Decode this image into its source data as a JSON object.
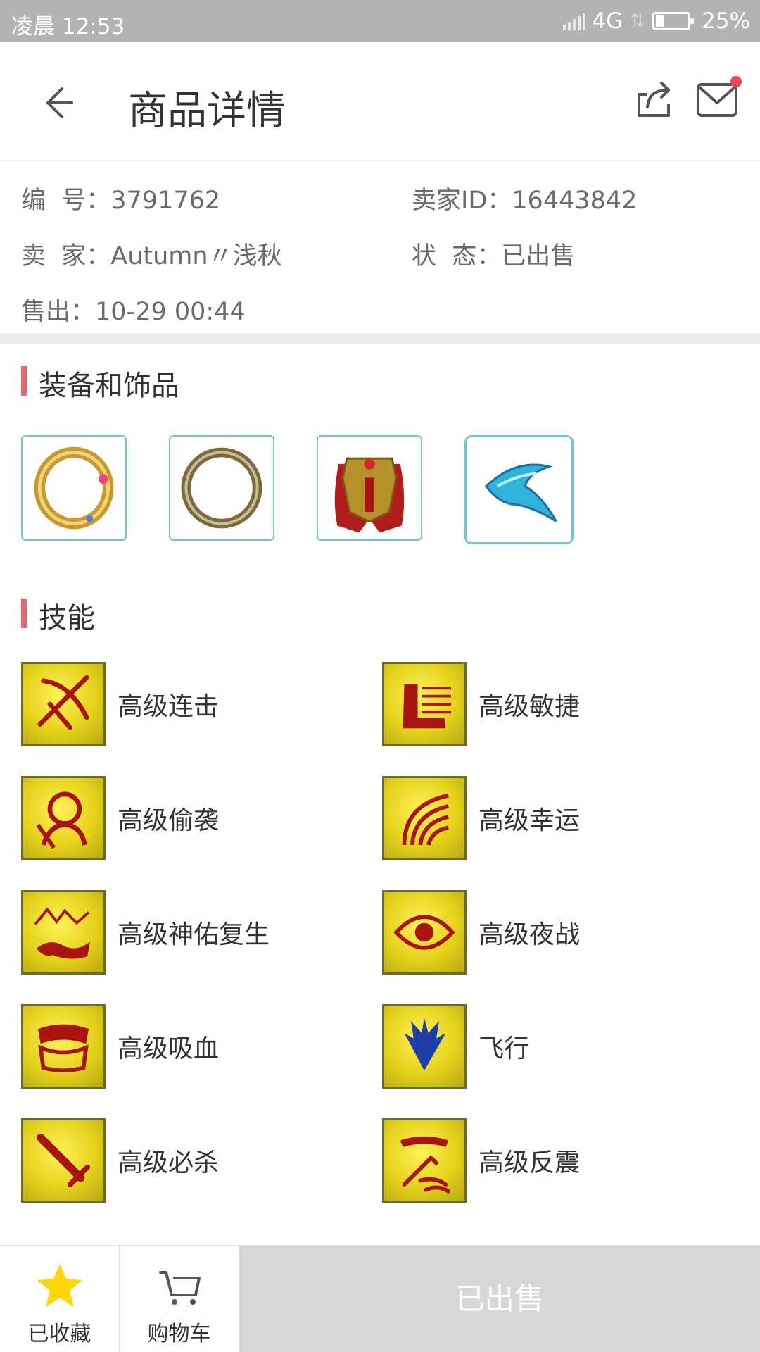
{
  "status_bar": {
    "time": "凌晨 12:53",
    "network": "4G",
    "battery": "25%",
    "battery_level": 0.25
  },
  "header": {
    "title": "商品详情"
  },
  "info": {
    "number_label": "编  号：",
    "number_value": "3791762",
    "seller_id_label": "卖家ID：",
    "seller_id_value": "16443842",
    "seller_label": "卖  家：",
    "seller_value": "Autumn〃浅秋",
    "state_label": "状  态：",
    "state_value": "已出售",
    "sold_label": "售出：",
    "sold_value": "10-29 00:44"
  },
  "equipment": {
    "title": "装备和饰品",
    "items": [
      {
        "icon": "gold-ring-icon"
      },
      {
        "icon": "silver-ring-icon"
      },
      {
        "icon": "golden-armor-icon"
      },
      {
        "icon": "blue-claw-icon"
      }
    ]
  },
  "skills": {
    "title": "技能",
    "items": [
      {
        "label": "高级连击",
        "icon": "crossbow-skill-icon"
      },
      {
        "label": "高级敏捷",
        "icon": "boot-skill-icon"
      },
      {
        "label": "高级偷袭",
        "icon": "sneak-skill-icon"
      },
      {
        "label": "高级幸运",
        "icon": "luck-skill-icon"
      },
      {
        "label": "高级神佑复生",
        "icon": "revive-skill-icon"
      },
      {
        "label": "高级夜战",
        "icon": "night-eye-skill-icon"
      },
      {
        "label": "高级吸血",
        "icon": "fangs-skill-icon"
      },
      {
        "label": "飞行",
        "icon": "wings-skill-icon"
      },
      {
        "label": "高级必杀",
        "icon": "sword-skill-icon"
      },
      {
        "label": "高级反震",
        "icon": "counter-skill-icon"
      }
    ]
  },
  "bottom": {
    "favorite_label": "已收藏",
    "cart_label": "购物车",
    "sold_button": "已出售"
  },
  "colors": {
    "accent": "#e06c72",
    "status_bar": "#b3b3b3",
    "star": "#ffd60a",
    "sold_button_bg": "#d7d7d7"
  }
}
